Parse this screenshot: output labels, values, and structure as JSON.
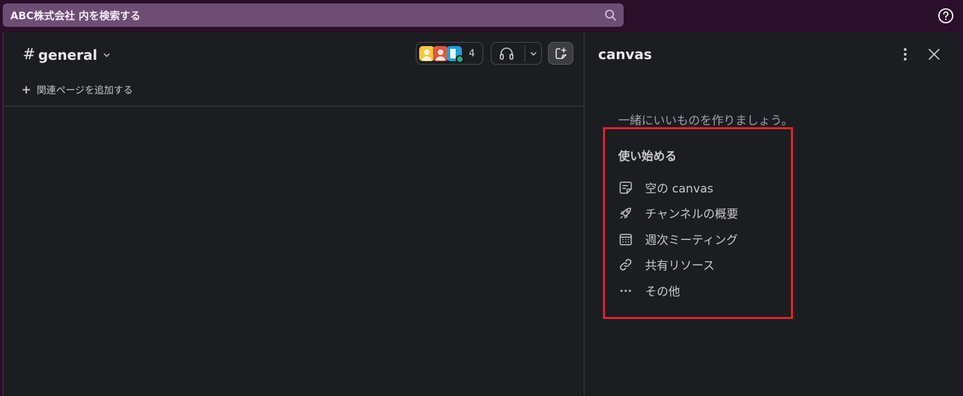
{
  "search": {
    "placeholder": "ABC株式会社 内を検索する"
  },
  "channel": {
    "name": "general",
    "member_count": "4",
    "add_bookmark_label": "関連ページを追加する"
  },
  "canvas_pane": {
    "title": "canvas",
    "intro": "一緒にいいものを作りましょう。",
    "section_title": "使い始める",
    "options": [
      {
        "label": "空の canvas",
        "icon": "canvas-note-icon"
      },
      {
        "label": "チャンネルの概要",
        "icon": "rocket-icon"
      },
      {
        "label": "週次ミーティング",
        "icon": "calendar-icon"
      },
      {
        "label": "共有リソース",
        "icon": "link-icon"
      },
      {
        "label": "その他",
        "icon": "more-dots-icon"
      }
    ]
  },
  "colors": {
    "topbar": "#2a0f2a",
    "search_bg": "#6e4d75",
    "pane_bg": "#1b1d21",
    "highlight": "#e0232a",
    "presence": "#2bac76"
  }
}
